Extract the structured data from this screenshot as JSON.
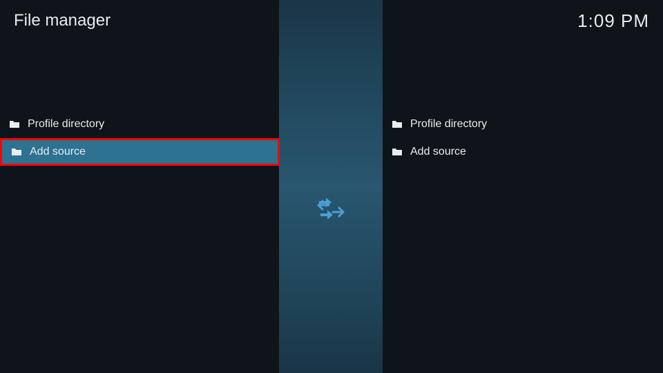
{
  "header": {
    "title": "File manager",
    "time": "1:09 PM"
  },
  "leftPanel": {
    "items": [
      {
        "label": "Profile directory",
        "selected": false,
        "highlighted": false
      },
      {
        "label": "Add source",
        "selected": true,
        "highlighted": true
      }
    ]
  },
  "rightPanel": {
    "items": [
      {
        "label": "Profile directory",
        "selected": false,
        "highlighted": false
      },
      {
        "label": "Add source",
        "selected": false,
        "highlighted": false
      }
    ]
  }
}
